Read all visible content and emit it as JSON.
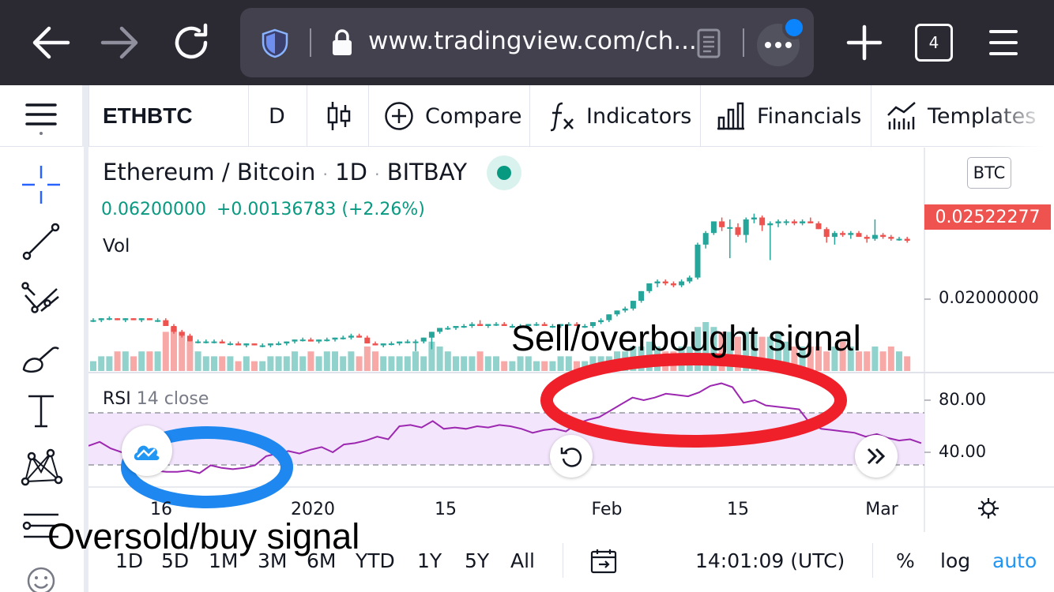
{
  "browser": {
    "url": "www.tradingview.com/ch...",
    "tab_count": "4"
  },
  "toolbar": {
    "symbol": "ETHBTC",
    "interval": "D",
    "compare_label": "Compare",
    "indicators_label": "Indicators",
    "financials_label": "Financials",
    "templates_label": "Templates"
  },
  "legend": {
    "title_symbol": "Ethereum / Bitcoin",
    "title_interval": "1D",
    "title_exchange": "BITBAY",
    "sep": "·",
    "price": "0.06200000",
    "change": "+0.00136783",
    "change_pct": "(+2.26%)",
    "vol_label": "Vol",
    "currency_badge": "BTC"
  },
  "price_axis": {
    "last_price": "0.02522277",
    "tick_020": "0.02000000"
  },
  "rsi": {
    "label": "RSI",
    "params": "14 close",
    "tick_80": "80.00",
    "tick_40": "40.00",
    "upper_band": 70,
    "lower_band": 30
  },
  "time_axis": {
    "ticks": [
      "16",
      "2020",
      "15",
      "Feb",
      "15",
      "Mar"
    ]
  },
  "bottom_bar": {
    "ranges": [
      "1D",
      "5D",
      "1M",
      "3M",
      "6M",
      "YTD",
      "1Y",
      "5Y",
      "All"
    ],
    "time": "14:01:09 (UTC)",
    "percent": "%",
    "log": "log",
    "auto": "auto"
  },
  "annotations": {
    "sell_signal": "Sell/overbought signal",
    "buy_signal": "Oversold/buy signal"
  },
  "colors": {
    "up": "#26a69a",
    "down": "#ef5350",
    "rsi_line": "#9c27b0",
    "rsi_band": "#f3e5fb",
    "sell_ellipse": "#f0202a",
    "buy_ellipse": "#1e88f0",
    "auto_blue": "#2196f3"
  },
  "chart_data": {
    "type": "candlestick",
    "symbol": "ETHBTC",
    "price_ticks": [
      0.02
    ],
    "last_price": 0.02522277,
    "price_range": [
      0.0165,
      0.0275
    ],
    "candles": [
      [
        0.019,
        0.0191,
        0.0189,
        0.019
      ],
      [
        0.019,
        0.0191,
        0.0189,
        0.0191
      ],
      [
        0.0191,
        0.0192,
        0.019,
        0.0191
      ],
      [
        0.0191,
        0.0191,
        0.019,
        0.019
      ],
      [
        0.019,
        0.0191,
        0.0189,
        0.0191
      ],
      [
        0.0191,
        0.0191,
        0.019,
        0.019
      ],
      [
        0.019,
        0.0191,
        0.0189,
        0.0191
      ],
      [
        0.0191,
        0.0191,
        0.019,
        0.019
      ],
      [
        0.019,
        0.0191,
        0.0189,
        0.019
      ],
      [
        0.019,
        0.0191,
        0.0187,
        0.0187
      ],
      [
        0.0187,
        0.0188,
        0.0183,
        0.0184
      ],
      [
        0.0184,
        0.0185,
        0.0181,
        0.0182
      ],
      [
        0.0182,
        0.0183,
        0.0179,
        0.0179
      ],
      [
        0.0179,
        0.018,
        0.0178,
        0.0179
      ],
      [
        0.0179,
        0.018,
        0.0178,
        0.0179
      ],
      [
        0.0179,
        0.018,
        0.0178,
        0.0179
      ],
      [
        0.0179,
        0.018,
        0.0178,
        0.0178
      ],
      [
        0.0178,
        0.0179,
        0.0177,
        0.0178
      ],
      [
        0.0178,
        0.0179,
        0.0177,
        0.0177
      ],
      [
        0.0177,
        0.0178,
        0.0176,
        0.0178
      ],
      [
        0.0178,
        0.0178,
        0.0177,
        0.0177
      ],
      [
        0.0177,
        0.0178,
        0.0176,
        0.0177
      ],
      [
        0.0177,
        0.0178,
        0.0176,
        0.0178
      ],
      [
        0.0178,
        0.0179,
        0.0177,
        0.0178
      ],
      [
        0.0178,
        0.0179,
        0.0177,
        0.0179
      ],
      [
        0.0179,
        0.018,
        0.0178,
        0.018
      ],
      [
        0.018,
        0.0181,
        0.0179,
        0.018
      ],
      [
        0.018,
        0.0181,
        0.0179,
        0.0179
      ],
      [
        0.0179,
        0.018,
        0.0178,
        0.018
      ],
      [
        0.018,
        0.0181,
        0.0179,
        0.018
      ],
      [
        0.018,
        0.0181,
        0.0179,
        0.0181
      ],
      [
        0.0181,
        0.0182,
        0.018,
        0.0181
      ],
      [
        0.0181,
        0.0183,
        0.018,
        0.0182
      ],
      [
        0.0182,
        0.0183,
        0.0181,
        0.0181
      ],
      [
        0.0181,
        0.0182,
        0.0178,
        0.0178
      ],
      [
        0.0178,
        0.0179,
        0.0177,
        0.0177
      ],
      [
        0.0177,
        0.0178,
        0.0176,
        0.0178
      ],
      [
        0.0178,
        0.0179,
        0.0177,
        0.0178
      ],
      [
        0.0178,
        0.0179,
        0.0177,
        0.0179
      ],
      [
        0.0179,
        0.018,
        0.0178,
        0.0179
      ],
      [
        0.0179,
        0.018,
        0.0174,
        0.0179
      ],
      [
        0.0179,
        0.0181,
        0.0178,
        0.0181
      ],
      [
        0.0181,
        0.0184,
        0.0175,
        0.0184
      ],
      [
        0.0184,
        0.0186,
        0.0183,
        0.0186
      ],
      [
        0.0186,
        0.0187,
        0.0185,
        0.0186
      ],
      [
        0.0186,
        0.0187,
        0.0185,
        0.0187
      ],
      [
        0.0187,
        0.0188,
        0.0186,
        0.0187
      ],
      [
        0.0187,
        0.0189,
        0.0186,
        0.0188
      ],
      [
        0.0188,
        0.019,
        0.0187,
        0.0187
      ],
      [
        0.0187,
        0.0188,
        0.0186,
        0.0188
      ],
      [
        0.0188,
        0.0189,
        0.0187,
        0.0188
      ],
      [
        0.0188,
        0.0189,
        0.0187,
        0.0187
      ],
      [
        0.0187,
        0.0188,
        0.0186,
        0.0187
      ],
      [
        0.0187,
        0.0188,
        0.0186,
        0.0187
      ],
      [
        0.0187,
        0.0188,
        0.0186,
        0.0188
      ],
      [
        0.0188,
        0.0189,
        0.0187,
        0.0188
      ],
      [
        0.0188,
        0.0189,
        0.0187,
        0.0187
      ],
      [
        0.0187,
        0.0188,
        0.0186,
        0.0187
      ],
      [
        0.0187,
        0.0188,
        0.0186,
        0.0188
      ],
      [
        0.0188,
        0.0189,
        0.0187,
        0.0188
      ],
      [
        0.0188,
        0.0189,
        0.0187,
        0.0187
      ],
      [
        0.0187,
        0.0188,
        0.0186,
        0.0187
      ],
      [
        0.0187,
        0.0189,
        0.0186,
        0.0189
      ],
      [
        0.0189,
        0.0191,
        0.0188,
        0.019
      ],
      [
        0.019,
        0.0193,
        0.0189,
        0.0193
      ],
      [
        0.0193,
        0.0195,
        0.0192,
        0.0195
      ],
      [
        0.0195,
        0.0197,
        0.0194,
        0.0196
      ],
      [
        0.0196,
        0.02,
        0.0195,
        0.02
      ],
      [
        0.02,
        0.0205,
        0.0199,
        0.0205
      ],
      [
        0.0205,
        0.0209,
        0.0204,
        0.0209
      ],
      [
        0.0209,
        0.0211,
        0.0207,
        0.021
      ],
      [
        0.021,
        0.0211,
        0.0208,
        0.0209
      ],
      [
        0.0209,
        0.021,
        0.0207,
        0.0208
      ],
      [
        0.0208,
        0.0211,
        0.0207,
        0.021
      ],
      [
        0.021,
        0.0213,
        0.0209,
        0.0212
      ],
      [
        0.0212,
        0.023,
        0.0211,
        0.0229
      ],
      [
        0.0229,
        0.0236,
        0.0227,
        0.0235
      ],
      [
        0.0235,
        0.0241,
        0.0234,
        0.0241
      ],
      [
        0.0241,
        0.0243,
        0.0236,
        0.0238
      ],
      [
        0.0238,
        0.0242,
        0.0222,
        0.0238
      ],
      [
        0.0238,
        0.024,
        0.0233,
        0.0234
      ],
      [
        0.0234,
        0.0243,
        0.023,
        0.0242
      ],
      [
        0.0242,
        0.0245,
        0.024,
        0.0243
      ],
      [
        0.0243,
        0.0244,
        0.0236,
        0.0239
      ],
      [
        0.0239,
        0.0241,
        0.0221,
        0.024
      ],
      [
        0.024,
        0.0242,
        0.0238,
        0.0241
      ],
      [
        0.0241,
        0.0242,
        0.0239,
        0.0241
      ],
      [
        0.0241,
        0.0242,
        0.0239,
        0.024
      ],
      [
        0.024,
        0.0242,
        0.0239,
        0.0241
      ],
      [
        0.0241,
        0.0243,
        0.024,
        0.024
      ],
      [
        0.024,
        0.0241,
        0.0237,
        0.0237
      ],
      [
        0.0237,
        0.0238,
        0.023,
        0.0233
      ],
      [
        0.0233,
        0.0236,
        0.0229,
        0.0235
      ],
      [
        0.0235,
        0.0236,
        0.0233,
        0.0234
      ],
      [
        0.0234,
        0.0236,
        0.0232,
        0.0235
      ],
      [
        0.0235,
        0.0236,
        0.0233,
        0.0233
      ],
      [
        0.0233,
        0.0234,
        0.023,
        0.0232
      ],
      [
        0.0232,
        0.0242,
        0.0231,
        0.0234
      ],
      [
        0.0234,
        0.0235,
        0.0232,
        0.0233
      ],
      [
        0.0233,
        0.0234,
        0.0231,
        0.0232
      ],
      [
        0.0232,
        0.0233,
        0.0231,
        0.0232
      ],
      [
        0.0232,
        0.0233,
        0.023,
        0.0231
      ]
    ],
    "volume": [
      2,
      3,
      3,
      4,
      4,
      3,
      4,
      4,
      4,
      8,
      9,
      8,
      6,
      4,
      3,
      3,
      3,
      3,
      2,
      3,
      2,
      2,
      3,
      3,
      3,
      4,
      3,
      4,
      3,
      4,
      4,
      3,
      4,
      3,
      5,
      4,
      3,
      3,
      3,
      3,
      4,
      3,
      6,
      5,
      4,
      3,
      3,
      3,
      4,
      3,
      3,
      2,
      2,
      3,
      3,
      2,
      2,
      2,
      3,
      3,
      2,
      2,
      3,
      3,
      3,
      4,
      4,
      5,
      5,
      6,
      5,
      4,
      4,
      5,
      5,
      9,
      10,
      9,
      8,
      8,
      7,
      8,
      8,
      7,
      7,
      8,
      6,
      5,
      5,
      5,
      5,
      4,
      5,
      6,
      5,
      4,
      4,
      5,
      4,
      5,
      4,
      3
    ],
    "rsi_series": [
      45,
      48,
      43,
      40,
      33,
      27,
      26,
      25,
      25,
      26,
      24,
      30,
      28,
      27,
      28,
      30,
      37,
      39,
      41,
      39,
      42,
      44,
      40,
      46,
      47,
      49,
      52,
      50,
      60,
      61,
      59,
      64,
      58,
      59,
      58,
      60,
      59,
      61,
      60,
      58,
      55,
      57,
      58,
      56,
      62,
      65,
      67,
      72,
      77,
      82,
      80,
      82,
      85,
      84,
      83,
      86,
      91,
      93,
      90,
      78,
      80,
      76,
      75,
      74,
      73,
      62,
      58,
      57,
      56,
      55,
      52,
      54,
      51,
      49,
      50,
      47
    ],
    "rsi_ticks": [
      40,
      80
    ],
    "x_ticks": [
      "16",
      "2020",
      "15",
      "Feb",
      "15",
      "Mar"
    ]
  }
}
